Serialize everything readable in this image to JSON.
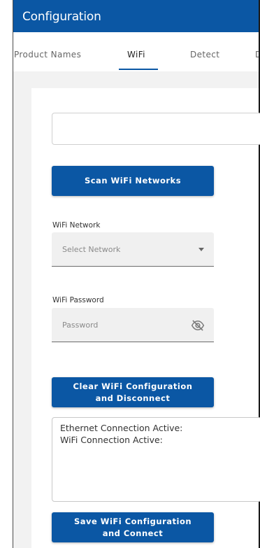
{
  "app": {
    "title": "Configuration"
  },
  "tabs": [
    {
      "label": "Product Names",
      "active": false
    },
    {
      "label": "WiFi",
      "active": true
    },
    {
      "label": "Detect",
      "active": false
    },
    {
      "label": "D",
      "active": false
    }
  ],
  "wifi": {
    "ssid_input": {
      "value": "",
      "placeholder": ""
    },
    "scan_button": "Scan WiFi Networks",
    "network_label": "WiFi Network",
    "network_select": {
      "placeholder": "Select Network",
      "icon": "chevron-down-icon"
    },
    "password_label": "WiFi Password",
    "password_input": {
      "placeholder": "Password",
      "icon": "visibility-off-icon"
    },
    "clear_button": "Clear WiFi Configuration\nand Disconnect",
    "status": {
      "ethernet": "Ethernet Connection Active:",
      "wifi": "WiFi Connection Active:"
    },
    "save_button": "Save WiFi Configuration\nand Connect"
  },
  "colors": {
    "primary": "#0b57a4",
    "background": "#f2f2f2",
    "card": "#ffffff"
  }
}
